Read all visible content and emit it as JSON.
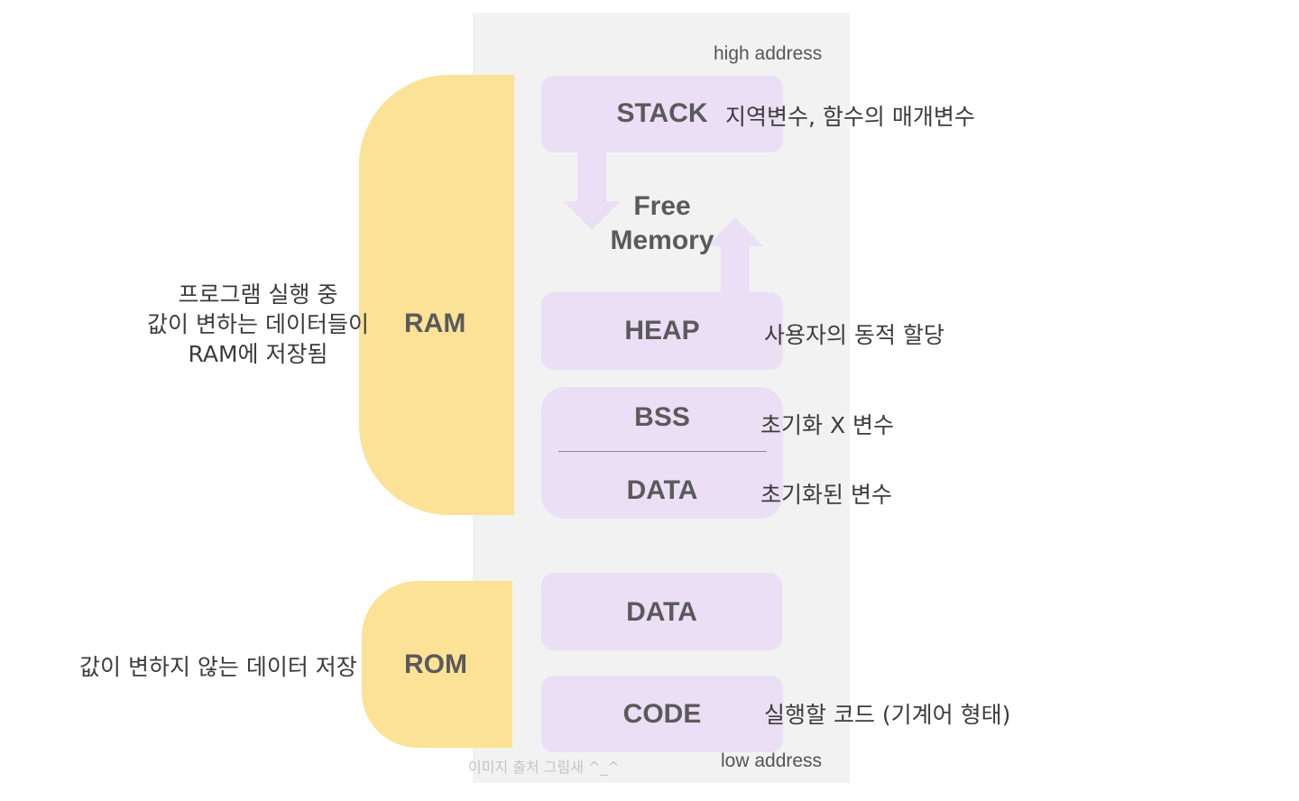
{
  "addresses": {
    "high": "high address",
    "low": "low address"
  },
  "regions": {
    "ram": {
      "label": "RAM",
      "description_lines": [
        "프로그램 실행 중",
        "값이 변하는 데이터들이",
        "RAM에 저장됨"
      ]
    },
    "rom": {
      "label": "ROM",
      "description": "값이 변하지 않는 데이터 저장"
    }
  },
  "segments": {
    "stack": {
      "label": "STACK",
      "description": "지역변수, 함수의 매개변수"
    },
    "free_memory": {
      "lines": [
        "Free",
        "Memory"
      ]
    },
    "heap": {
      "label": "HEAP",
      "description": "사용자의 동적 할당"
    },
    "bss": {
      "label": "BSS",
      "description": "초기화 X 변수"
    },
    "data": {
      "label": "DATA",
      "description": "초기화된 변수"
    },
    "rom_data": {
      "label": "DATA"
    },
    "code": {
      "label": "CODE",
      "description": "실행할 코드 (기계어 형태)"
    }
  },
  "credit": "이미지 출처 그림새 ^_^",
  "colors": {
    "memory_column": "#f2f2f2",
    "segment_fill": "#eadff5",
    "region_tab": "#fce297",
    "label_text": "#5a5a5a"
  },
  "icons": {
    "stack_growth": "arrow-down-icon",
    "heap_growth": "arrow-up-icon"
  }
}
